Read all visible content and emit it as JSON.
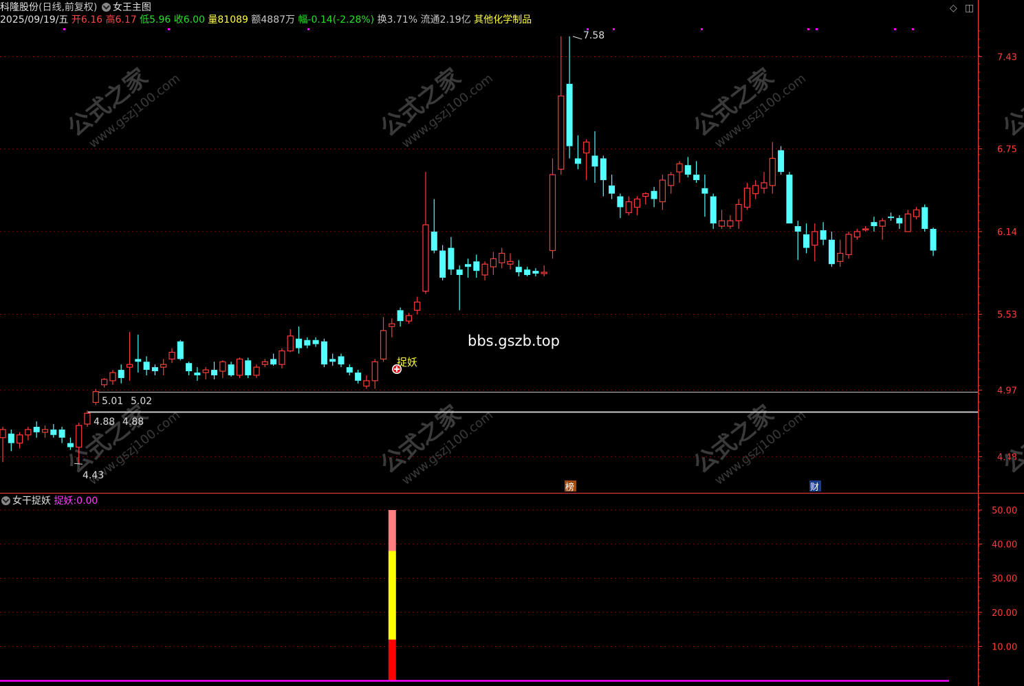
{
  "header": {
    "stock_name": "科隆股份",
    "period": "(日线,前复权)",
    "indicator_main": "女王主图",
    "date": "2025/09/19/五",
    "open_label": "开",
    "open": "6.16",
    "high_label": "高",
    "high": "6.17",
    "low_label": "低",
    "low": "5.96",
    "close_label": "收",
    "close": "6.00",
    "volume_label": "量",
    "volume": "81089",
    "amount_label": "额",
    "amount": "4887万",
    "change_label": "幅",
    "change": "-0.14(-2.28%)",
    "turnover_label": "换",
    "turnover": "3.71%",
    "float_label": "流通",
    "float": "2.19亿",
    "sector": "其他化学制品"
  },
  "sub_header": {
    "indicator": "女干捉妖",
    "series_label": "捉妖:",
    "series_value": "0.00"
  },
  "watermark": {
    "site": "bbs.gszb.top",
    "stamp_cn": "公式之家",
    "stamp_url": "www.gszj100.com"
  },
  "markers": {
    "signal": "捉妖",
    "bang": "榜",
    "cai": "财"
  },
  "annotations": {
    "high_peak": "7.58",
    "low_trough": "4.43",
    "level1_a": "5.01",
    "level1_b": "5.02",
    "level2_a": "4.88",
    "level2_b": "4.88"
  },
  "colors": {
    "up": "#ff3c3c",
    "down": "#54ffff",
    "grid": "#8b0000",
    "axis": "#ff3c3c",
    "magenta": "#ff00ff",
    "bar_red": "#ff0000",
    "bar_yellow": "#ffff00",
    "bar_pink": "#ff8080"
  },
  "chart_data": [
    {
      "type": "candlestick",
      "ylim": [
        4.36,
        7.62
      ],
      "yticks": [
        4.48,
        4.97,
        5.53,
        6.14,
        6.75,
        7.43
      ],
      "ohlc": [
        [
          4.62,
          4.7,
          4.44,
          4.68
        ],
        [
          4.65,
          4.68,
          4.52,
          4.58
        ],
        [
          4.58,
          4.66,
          4.54,
          4.64
        ],
        [
          4.64,
          4.7,
          4.6,
          4.68
        ],
        [
          4.7,
          4.74,
          4.62,
          4.66
        ],
        [
          4.66,
          4.71,
          4.62,
          4.68
        ],
        [
          4.68,
          4.72,
          4.62,
          4.64
        ],
        [
          4.68,
          4.7,
          4.58,
          4.62
        ],
        [
          4.58,
          4.62,
          4.53,
          4.55
        ],
        [
          4.55,
          4.73,
          4.43,
          4.71
        ],
        [
          4.72,
          4.82,
          4.7,
          4.8
        ],
        [
          4.88,
          4.98,
          4.86,
          4.96
        ],
        [
          5.01,
          5.06,
          4.99,
          5.05
        ],
        [
          5.04,
          5.12,
          5.01,
          5.1
        ],
        [
          5.12,
          5.16,
          5.02,
          5.06
        ],
        [
          5.14,
          5.4,
          5.04,
          5.16
        ],
        [
          5.2,
          5.38,
          5.1,
          5.18
        ],
        [
          5.18,
          5.22,
          5.08,
          5.12
        ],
        [
          5.14,
          5.16,
          5.08,
          5.11
        ],
        [
          5.14,
          5.2,
          5.08,
          5.16
        ],
        [
          5.2,
          5.28,
          5.17,
          5.25
        ],
        [
          5.33,
          5.34,
          5.19,
          5.2
        ],
        [
          5.17,
          5.18,
          5.08,
          5.11
        ],
        [
          5.1,
          5.14,
          5.04,
          5.08
        ],
        [
          5.1,
          5.14,
          5.05,
          5.12
        ],
        [
          5.12,
          5.18,
          5.05,
          5.08
        ],
        [
          5.11,
          5.19,
          5.06,
          5.18
        ],
        [
          5.16,
          5.18,
          5.07,
          5.08
        ],
        [
          5.08,
          5.21,
          5.06,
          5.2
        ],
        [
          5.19,
          5.21,
          5.06,
          5.08
        ],
        [
          5.08,
          5.16,
          5.06,
          5.14
        ],
        [
          5.16,
          5.2,
          5.14,
          5.18
        ],
        [
          5.2,
          5.24,
          5.15,
          5.16
        ],
        [
          5.16,
          5.28,
          5.13,
          5.26
        ],
        [
          5.26,
          5.42,
          5.25,
          5.37
        ],
        [
          5.35,
          5.44,
          5.24,
          5.28
        ],
        [
          5.34,
          5.36,
          5.28,
          5.3
        ],
        [
          5.34,
          5.36,
          5.29,
          5.31
        ],
        [
          5.33,
          5.35,
          5.14,
          5.16
        ],
        [
          5.2,
          5.24,
          5.15,
          5.18
        ],
        [
          5.22,
          5.24,
          5.14,
          5.16
        ],
        [
          5.14,
          5.16,
          5.08,
          5.1
        ],
        [
          5.1,
          5.12,
          5.02,
          5.04
        ],
        [
          5.0,
          5.08,
          4.98,
          5.04
        ],
        [
          5.04,
          5.2,
          4.98,
          5.18
        ],
        [
          5.2,
          5.51,
          5.18,
          5.41
        ],
        [
          5.44,
          5.5,
          5.36,
          5.46
        ],
        [
          5.56,
          5.58,
          5.44,
          5.48
        ],
        [
          5.48,
          5.54,
          5.46,
          5.52
        ],
        [
          5.56,
          5.66,
          5.53,
          5.62
        ],
        [
          5.7,
          6.58,
          5.68,
          6.19
        ],
        [
          6.14,
          6.38,
          5.98,
          6.0
        ],
        [
          6.0,
          6.04,
          5.78,
          5.8
        ],
        [
          6.02,
          6.1,
          5.82,
          5.86
        ],
        [
          5.86,
          5.89,
          5.56,
          5.82
        ],
        [
          5.9,
          5.94,
          5.8,
          5.88
        ],
        [
          5.92,
          5.97,
          5.8,
          5.85
        ],
        [
          5.82,
          5.92,
          5.78,
          5.9
        ],
        [
          5.88,
          5.99,
          5.82,
          5.94
        ],
        [
          5.91,
          6.02,
          5.87,
          5.98
        ],
        [
          5.9,
          5.98,
          5.86,
          5.92
        ],
        [
          5.88,
          5.93,
          5.81,
          5.84
        ],
        [
          5.86,
          5.88,
          5.81,
          5.82
        ],
        [
          5.85,
          5.87,
          5.81,
          5.83
        ],
        [
          5.83,
          5.89,
          5.81,
          5.84
        ],
        [
          6.0,
          6.68,
          5.94,
          6.56
        ],
        [
          6.6,
          7.58,
          6.56,
          7.14
        ],
        [
          7.23,
          7.58,
          6.68,
          6.77
        ],
        [
          6.68,
          6.85,
          6.6,
          6.64
        ],
        [
          6.72,
          6.82,
          6.52,
          6.8
        ],
        [
          6.7,
          6.88,
          6.5,
          6.62
        ],
        [
          6.68,
          6.7,
          6.4,
          6.52
        ],
        [
          6.48,
          6.56,
          6.38,
          6.42
        ],
        [
          6.4,
          6.42,
          6.24,
          6.32
        ],
        [
          6.28,
          6.4,
          6.26,
          6.36
        ],
        [
          6.32,
          6.4,
          6.26,
          6.38
        ],
        [
          6.4,
          6.43,
          6.34,
          6.42
        ],
        [
          6.44,
          6.47,
          6.32,
          6.38
        ],
        [
          6.36,
          6.56,
          6.3,
          6.52
        ],
        [
          6.48,
          6.58,
          6.42,
          6.56
        ],
        [
          6.58,
          6.66,
          6.5,
          6.64
        ],
        [
          6.63,
          6.69,
          6.54,
          6.56
        ],
        [
          6.56,
          6.66,
          6.5,
          6.52
        ],
        [
          6.46,
          6.56,
          6.25,
          6.42
        ],
        [
          6.4,
          6.42,
          6.16,
          6.2
        ],
        [
          6.18,
          6.3,
          6.16,
          6.22
        ],
        [
          6.18,
          6.26,
          6.16,
          6.22
        ],
        [
          6.22,
          6.38,
          6.16,
          6.34
        ],
        [
          6.32,
          6.5,
          6.3,
          6.46
        ],
        [
          6.42,
          6.52,
          6.38,
          6.48
        ],
        [
          6.46,
          6.58,
          6.42,
          6.5
        ],
        [
          6.48,
          6.8,
          6.42,
          6.68
        ],
        [
          6.74,
          6.77,
          6.56,
          6.58
        ],
        [
          6.56,
          6.58,
          6.2,
          6.2
        ],
        [
          6.18,
          6.22,
          5.93,
          6.14
        ],
        [
          6.12,
          6.2,
          5.98,
          6.02
        ],
        [
          6.04,
          6.2,
          5.92,
          6.14
        ],
        [
          6.15,
          6.21,
          6.04,
          6.08
        ],
        [
          6.08,
          6.14,
          5.88,
          5.9
        ],
        [
          5.92,
          6.08,
          5.88,
          5.98
        ],
        [
          5.97,
          6.14,
          5.94,
          6.12
        ],
        [
          6.1,
          6.16,
          6.08,
          6.14
        ],
        [
          6.16,
          6.18,
          6.14,
          6.16
        ],
        [
          6.21,
          6.25,
          6.14,
          6.18
        ],
        [
          6.18,
          6.24,
          6.08,
          6.22
        ],
        [
          6.25,
          6.28,
          6.22,
          6.24
        ],
        [
          6.24,
          6.26,
          6.16,
          6.2
        ],
        [
          6.14,
          6.3,
          6.14,
          6.27
        ],
        [
          6.25,
          6.32,
          6.23,
          6.3
        ],
        [
          6.32,
          6.34,
          6.14,
          6.16
        ],
        [
          6.16,
          6.17,
          5.96,
          6.0
        ]
      ]
    },
    {
      "type": "bar",
      "title": "女干捉妖",
      "ylim": [
        0,
        50
      ],
      "yticks": [
        10,
        20,
        30,
        40,
        50
      ],
      "signal_index": 46,
      "segments": [
        {
          "from": 0,
          "to": 12,
          "color": "#ff0000"
        },
        {
          "from": 12,
          "to": 38,
          "color": "#ffff00"
        },
        {
          "from": 38,
          "to": 50,
          "color": "#ff8080"
        }
      ],
      "baseline_value": 0.0
    }
  ]
}
